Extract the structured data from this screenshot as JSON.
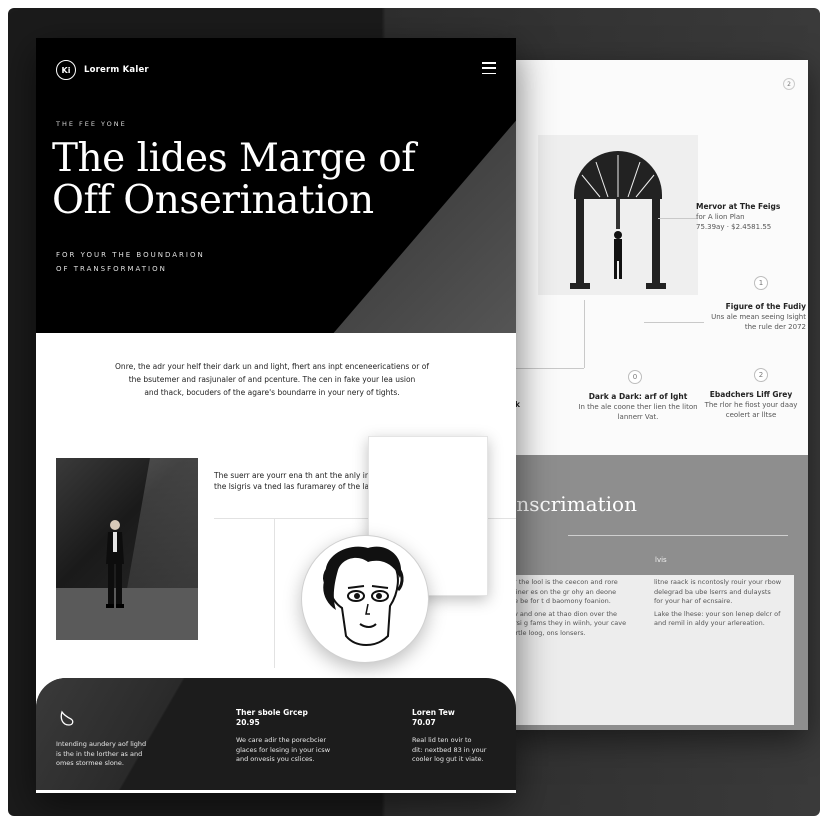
{
  "header": {
    "logo_mark": "Ki",
    "brand": "Lorerm Kaler"
  },
  "hero": {
    "eyebrow": "THE FEE YONE",
    "title_line1": "The lides Marge of",
    "title_line2": "Off Onserination",
    "sub_line1": "FOR YOUR THE BOUNDARION",
    "sub_line2": "OF TRANSFORMATION"
  },
  "intro": {
    "line1": "Onre, the adr your helf their dark un and light, fhert ans inpt enceneericatiens or of",
    "line2": "the bsutemer and rasjunaler of and pcenture. The cen in fake your lea usion",
    "line3": "and thack, bocuders of the agare's boundarre in your nery of tights."
  },
  "feature": {
    "quote_line1": "The suerr are yourr ena th ant the anly in you cank for",
    "quote_line2": "the lsigris va tned las furamarey of the laving inproates."
  },
  "footer": {
    "col1_line1": "Intending aundery aof lighd",
    "col1_line2": "is the in the lorther as and",
    "col1_line3": "omes stormee slone.",
    "col2_title": "Ther sbole Grcep",
    "col2_price": "20.95",
    "col2_line1": "We care adir the porecbcier",
    "col2_line2": "glaces for lesing in your icsw",
    "col2_line3": "and onvesis you cslices.",
    "col3_title": "Loren Tew",
    "col3_price": "70.07",
    "col3_line1": "Real lid ten ovir to",
    "col3_line2": "dit: nextbed 83 in your",
    "col3_line3": "cooler log gut it viate."
  },
  "back_page": {
    "page_indicator": "2",
    "caption1_title": "Mervor at The Feigs",
    "caption1_line2": "for A lion Plan",
    "caption1_line3": "75.39ay · $2.4581.55",
    "dot1": "1",
    "caption2_title": "Figure of the Fudiy",
    "caption2_line1": "Uns ale mean seeing Isight",
    "caption2_line2": "the rule der 2072",
    "dot2": "0",
    "caption3_title": "Dark a Dark: arf of Ight",
    "caption3_line1": "In the ale coone ther lien the liton",
    "caption3_line2": "lannerr Vat.",
    "dot3": "2",
    "caption4_title": "Ebadchers Liff Grey",
    "caption4_line1": "The rlor he fiost your daay",
    "caption4_line2": "ceolert ar lltse",
    "edge_text": "ak",
    "section_title": "inscrimation",
    "tag": "lvis",
    "left_col": [
      "er the lool is the ceecon and rore",
      "aliner es on the gr ohy an deone",
      "ee be for t d baomony foanion.",
      "ev and one at thao dion over the",
      "ersi g fams they in wiinh, your cave",
      "s rtle loog, ons lonsers."
    ],
    "right_col": [
      "litne raack is ncontosly rouir your rbow",
      "delegrad ba ube lserrs and dulaysts",
      "for your har of ecnsaire.",
      "Lake the lhese: your son lenep delcr of",
      "and remil in aldy your arlereation."
    ]
  },
  "colors": {
    "hero_bg": "#000000",
    "footer_bg": "#1c1c1c",
    "frame_bg": "#1b1b1b"
  },
  "icons": [
    "menu-icon",
    "logo-mark",
    "leaf-icon"
  ]
}
